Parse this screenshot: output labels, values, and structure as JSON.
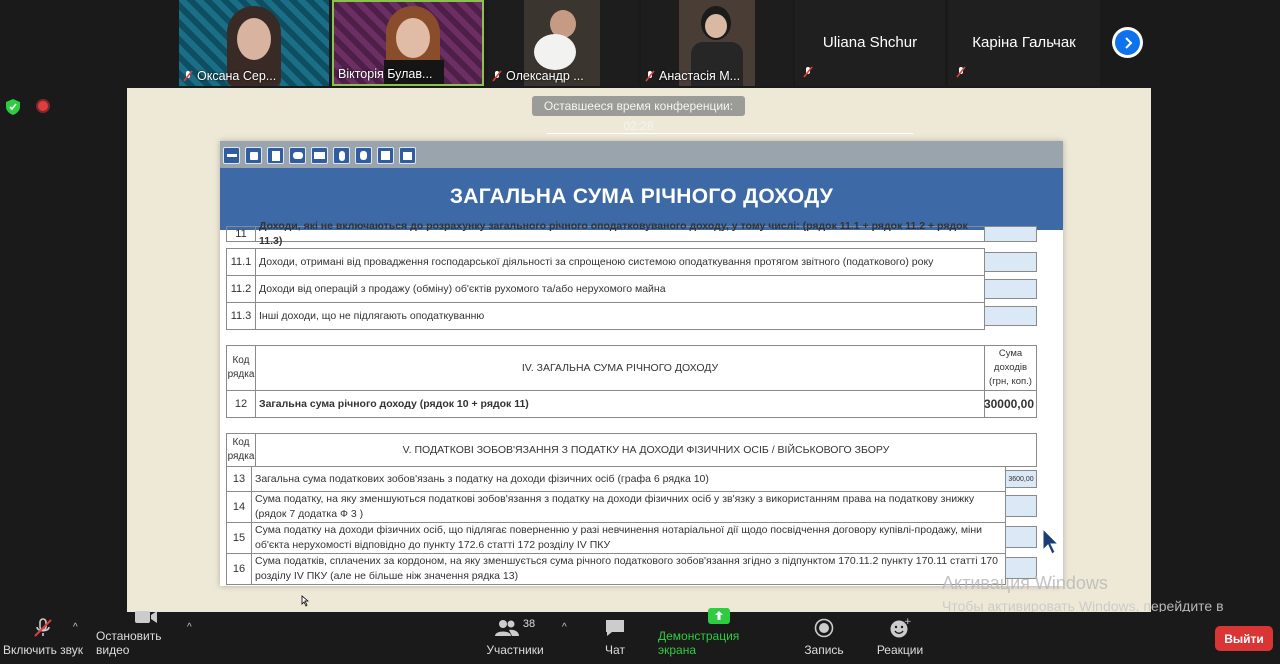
{
  "meeting": {
    "timer_text": "Оставшееся время конференции: 02:28",
    "participants": [
      {
        "name": "Оксана Сер..."
      },
      {
        "name": "Вікторія Булав..."
      },
      {
        "name": "Олександр ..."
      },
      {
        "name": "Анастасія М..."
      },
      {
        "name": "Uliana Shchur"
      },
      {
        "name": "Каріна Гальчак"
      }
    ]
  },
  "slide": {
    "banner_title": "ЗАГАЛЬНА СУМА РІЧНОГО ДОХОДУ",
    "section1_rows": [
      {
        "code": "11",
        "text": "Доходи, які не включаються до розрахунку загального річного оподатковуваного доходу, у тому числі: (рядок 11.1 + рядок 11.2 + рядок 11.3)"
      },
      {
        "code": "11.1",
        "text": "Доходи, отримані від провадження господарської діяльності за спрощеною системою оподаткування протягом звітного (податкового) року"
      },
      {
        "code": "11.2",
        "text": "Доходи від операцій з продажу (обміну) об'єктів рухомого та/або нерухомого майна"
      },
      {
        "code": "11.3",
        "text": "Інші доходи, що не підлягають оподаткуванню"
      }
    ],
    "section4": {
      "code_header": "Код рядка",
      "title": "IV. ЗАГАЛЬНА СУМА РІЧНОГО ДОХОДУ",
      "sum_header": "Сума доходів (грн, коп.)",
      "row": {
        "code": "12",
        "text": "Загальна сума річного доходу (рядок 10 + рядок 11)",
        "value": "30000,00"
      }
    },
    "section5": {
      "code_header": "Код рядка",
      "title": "V. ПОДАТКОВІ ЗОБОВ'ЯЗАННЯ З ПОДАТКУ НА ДОХОДИ ФІЗИЧНИХ ОСІБ / ВІЙСЬКОВОГО ЗБОРУ",
      "rows": [
        {
          "code": "13",
          "text": "Загальна сума податкових зобов'язань з податку на доходи фізичних осіб (графа 6 рядка 10)",
          "value": "3600,00"
        },
        {
          "code": "14",
          "text": "Сума податку, на яку зменшуються податкові зобов'язання з податку на доходи фізичних осіб у зв'язку з використанням права на податкову знижку (рядок 7 додатка Ф 3 )",
          "value": ""
        },
        {
          "code": "15",
          "text": "Сума податку на доходи фізичних осіб, що підлягає поверненню у разі невчинення нотаріальної дії щодо посвідчення договору купівлі-продажу, міни об'єкта нерухомості відповідно до пункту 172.6 статті 172 розділу IV ПКУ",
          "value": ""
        },
        {
          "code": "16",
          "text": "Сума податків, сплачених за кордоном, на яку зменшується сума річного податкового зобов'язання згідно з підпунктом 170.11.2 пункту 170.11 статті 170 розділу IV ПКУ (але не більше ніж значення рядка 13)",
          "value": ""
        }
      ]
    }
  },
  "watermark": {
    "title": "Активация Windows",
    "subtitle": "Чтобы активировать Windows, перейдите в раздел \"Параметры\"."
  },
  "toolbar": {
    "audio": "Включить звук",
    "video": "Остановить видео",
    "participants": "Участники",
    "participants_count": "38",
    "chat": "Чат",
    "share": "Демонстрация экрана",
    "record": "Запись",
    "reactions": "Реакции",
    "exit": "Выйти"
  },
  "colors": {
    "accent_green": "#2ecc40",
    "exit_red": "#d93535",
    "zoom_blue": "#0e72ed",
    "banner_blue": "#3d6aa6"
  }
}
